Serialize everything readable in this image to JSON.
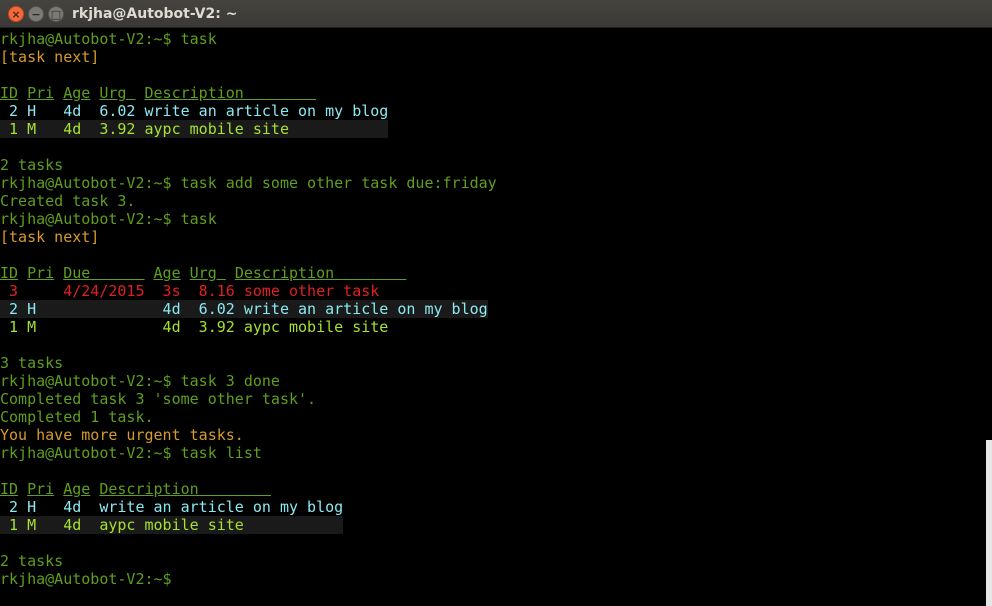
{
  "window": {
    "title": "rkjha@Autobot-V2: ~",
    "close_glyph": "×",
    "min_glyph": "−",
    "max_glyph": "□"
  },
  "lines": [
    {
      "segments": [
        {
          "t": "rkjha@Autobot-V2:~$ task",
          "c": "prompt"
        }
      ]
    },
    {
      "segments": [
        {
          "t": "[task next]",
          "c": "orange"
        }
      ]
    },
    {
      "segments": []
    },
    {
      "segments": [
        {
          "t": "ID",
          "c": "hdr"
        },
        {
          "t": " ",
          "c": ""
        },
        {
          "t": "Pri",
          "c": "hdr"
        },
        {
          "t": " ",
          "c": ""
        },
        {
          "t": "Age",
          "c": "hdr"
        },
        {
          "t": " ",
          "c": ""
        },
        {
          "t": "Urg ",
          "c": "hdr"
        },
        {
          "t": " ",
          "c": ""
        },
        {
          "t": "Description        ",
          "c": "hdr"
        }
      ]
    },
    {
      "segments": [
        {
          "t": " 2 H   4d  6.02 write an article on my blog",
          "c": "cyan"
        }
      ],
      "alt": false
    },
    {
      "segments": [
        {
          "t": " 1 M   4d  3.92 aypc mobile site           ",
          "c": "green2"
        }
      ],
      "alt": true
    },
    {
      "segments": []
    },
    {
      "segments": [
        {
          "t": "2 tasks",
          "c": "prompt"
        }
      ]
    },
    {
      "segments": [
        {
          "t": "rkjha@Autobot-V2:~$ task add some other task due:friday",
          "c": "prompt"
        }
      ]
    },
    {
      "segments": [
        {
          "t": "Created task 3.",
          "c": "prompt"
        }
      ]
    },
    {
      "segments": [
        {
          "t": "rkjha@Autobot-V2:~$ task",
          "c": "prompt"
        }
      ]
    },
    {
      "segments": [
        {
          "t": "[task next]",
          "c": "orange"
        }
      ]
    },
    {
      "segments": []
    },
    {
      "segments": [
        {
          "t": "ID",
          "c": "hdr"
        },
        {
          "t": " ",
          "c": ""
        },
        {
          "t": "Pri",
          "c": "hdr"
        },
        {
          "t": " ",
          "c": ""
        },
        {
          "t": "Due      ",
          "c": "hdr"
        },
        {
          "t": " ",
          "c": ""
        },
        {
          "t": "Age",
          "c": "hdr"
        },
        {
          "t": " ",
          "c": ""
        },
        {
          "t": "Urg ",
          "c": "hdr"
        },
        {
          "t": " ",
          "c": ""
        },
        {
          "t": "Description        ",
          "c": "hdr"
        }
      ]
    },
    {
      "segments": [
        {
          "t": " 3     4/24/2015  3s  8.16 some other task",
          "c": "red"
        }
      ]
    },
    {
      "segments": [
        {
          "t": " 2 H              4d  6.02 write an article on my blog",
          "c": "cyan"
        }
      ],
      "alt": true
    },
    {
      "segments": [
        {
          "t": " 1 M              4d  3.92 aypc mobile site",
          "c": "green2"
        }
      ]
    },
    {
      "segments": []
    },
    {
      "segments": [
        {
          "t": "3 tasks",
          "c": "prompt"
        }
      ]
    },
    {
      "segments": [
        {
          "t": "rkjha@Autobot-V2:~$ task 3 done",
          "c": "prompt"
        }
      ]
    },
    {
      "segments": [
        {
          "t": "Completed task 3 'some other task'.",
          "c": "prompt"
        }
      ]
    },
    {
      "segments": [
        {
          "t": "Completed 1 task.",
          "c": "prompt"
        }
      ]
    },
    {
      "segments": [
        {
          "t": "You have more urgent tasks.",
          "c": "orange"
        }
      ]
    },
    {
      "segments": [
        {
          "t": "rkjha@Autobot-V2:~$ task list",
          "c": "prompt"
        }
      ]
    },
    {
      "segments": []
    },
    {
      "segments": [
        {
          "t": "ID",
          "c": "hdr"
        },
        {
          "t": " ",
          "c": ""
        },
        {
          "t": "Pri",
          "c": "hdr"
        },
        {
          "t": " ",
          "c": ""
        },
        {
          "t": "Age",
          "c": "hdr"
        },
        {
          "t": " ",
          "c": ""
        },
        {
          "t": "Description        ",
          "c": "hdr"
        }
      ]
    },
    {
      "segments": [
        {
          "t": " 2 H   4d  write an article on my blog",
          "c": "cyan"
        }
      ],
      "alt": false
    },
    {
      "segments": [
        {
          "t": " 1 M   4d  aypc mobile site           ",
          "c": "green2"
        }
      ],
      "alt": true
    },
    {
      "segments": []
    },
    {
      "segments": [
        {
          "t": "2 tasks",
          "c": "prompt"
        }
      ]
    },
    {
      "segments": [
        {
          "t": "rkjha@Autobot-V2:~$",
          "c": "prompt"
        }
      ]
    }
  ]
}
